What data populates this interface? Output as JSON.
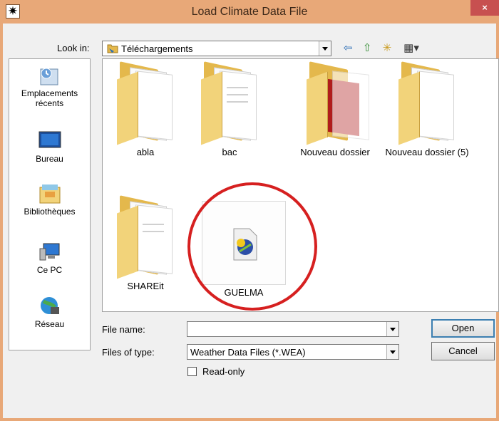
{
  "window": {
    "title": "Load Climate Data File",
    "close": "×",
    "app_icon": "✷"
  },
  "lookin": {
    "label": "Look in:",
    "value": "Téléchargements"
  },
  "toolbar": {
    "back": "⇦",
    "up": "⇧",
    "new_folder": "✳",
    "view": "▦▾"
  },
  "places": [
    {
      "label": "Emplacements récents",
      "icon": "recent-places-icon"
    },
    {
      "label": "Bureau",
      "icon": "desktop-icon"
    },
    {
      "label": "Bibliothèques",
      "icon": "libraries-icon"
    },
    {
      "label": "Ce PC",
      "icon": "computer-icon"
    },
    {
      "label": "Réseau",
      "icon": "network-icon"
    }
  ],
  "files": [
    {
      "name": "abla",
      "type": "folder"
    },
    {
      "name": "bac",
      "type": "folder"
    },
    {
      "name": "Nouveau dossier",
      "type": "folder"
    },
    {
      "name": "Nouveau dossier (5)",
      "type": "folder"
    },
    {
      "name": "SHAREit",
      "type": "folder"
    },
    {
      "name": "GUELMA",
      "type": "weather-file"
    }
  ],
  "form": {
    "filename_label": "File name:",
    "filename_value": "",
    "filetype_label": "Files of type:",
    "filetype_value": "Weather Data Files (*.WEA)",
    "readonly_label": "Read-only"
  },
  "buttons": {
    "open": "Open",
    "cancel": "Cancel"
  },
  "colors": {
    "titlebar": "#e8a878",
    "close": "#c75050",
    "highlight_circle": "#d62020",
    "folder": "#e4b84c"
  }
}
